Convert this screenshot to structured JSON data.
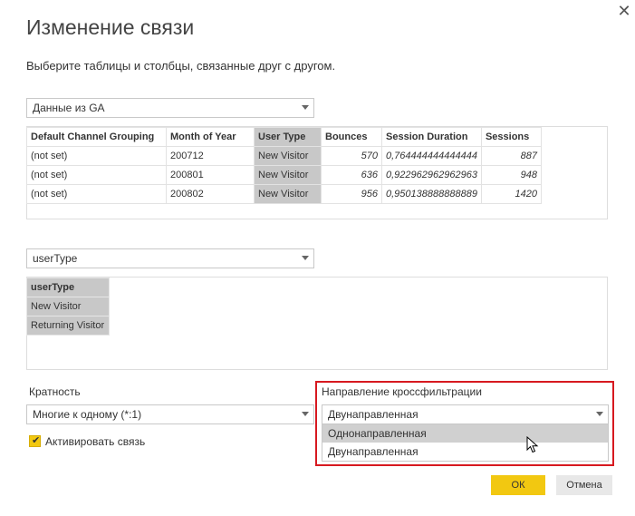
{
  "dialog": {
    "title": "Изменение связи",
    "subtitle": "Выберите таблицы и столбцы, связанные друг с другом.",
    "close_icon": "close-icon"
  },
  "table1": {
    "selector_value": "Данные из GA",
    "columns": [
      "Default Channel Grouping",
      "Month of Year",
      "User Type",
      "Bounces",
      "Session Duration",
      "Sessions"
    ],
    "selected_column": 2,
    "rows": [
      [
        "(not set)",
        "200712",
        "New Visitor",
        "570",
        "0,764444444444444",
        "887"
      ],
      [
        "(not set)",
        "200801",
        "New Visitor",
        "636",
        "0,922962962962963",
        "948"
      ],
      [
        "(not set)",
        "200802",
        "New Visitor",
        "956",
        "0,950138888888889",
        "1420"
      ]
    ]
  },
  "table2": {
    "selector_value": "userType",
    "column": "userType",
    "rows": [
      "New Visitor",
      "Returning Visitor"
    ]
  },
  "cardinality": {
    "label": "Кратность",
    "value": "Многие к одному (*:1)"
  },
  "activate": {
    "label": "Активировать связь",
    "checked": true
  },
  "crossfilter": {
    "label": "Направление кроссфильтрации",
    "value": "Двунаправленная",
    "options": [
      "Однонаправленная",
      "Двунаправленная"
    ],
    "highlight_color": "#d71920"
  },
  "buttons": {
    "ok_label": "ОК",
    "cancel_label": "Отмена",
    "accent_color": "#f2c811"
  }
}
